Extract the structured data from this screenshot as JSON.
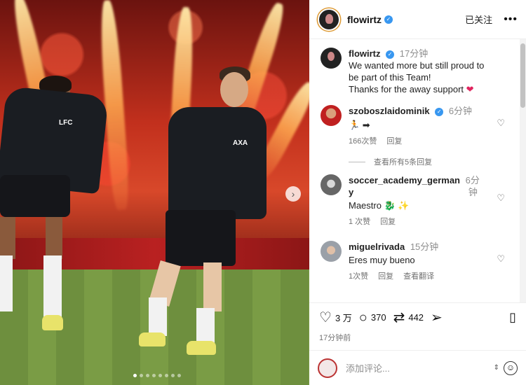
{
  "post": {
    "username": "flowirtz",
    "follow_label": "已关注",
    "more_label": "•••",
    "caption_time": "17分钟",
    "caption_line1": "We wanted more but still proud to",
    "caption_line2": "be part of this Team!",
    "caption_line3": "Thanks for the away support",
    "caption_heart": "❤",
    "next_arrow": "›",
    "carousel_index": 1,
    "carousel_total": 8
  },
  "comments": [
    {
      "username": "szoboszlaidominik",
      "time": "6分钟",
      "text": "🏃 ➡",
      "likes": "166次赞",
      "reply": "回复",
      "view_replies": "查看所有5条回复"
    },
    {
      "username_line1": "soccer_academy_german",
      "username_line2": "y",
      "time_line1": "6分",
      "time_line2": "钟",
      "text": "Maestro 🐉 ✨",
      "likes": "1 次赞",
      "reply": "回复"
    },
    {
      "username": "miguelrivada",
      "time": "15分钟",
      "text": "Eres muy bueno",
      "likes": "1次赞",
      "reply": "回复",
      "translate": "查看翻译"
    }
  ],
  "actions": {
    "likes": "3 万",
    "comments": "370",
    "reposts": "442",
    "posted": "17分钟前"
  },
  "composer": {
    "placeholder": "添加评论..."
  },
  "icons": {
    "verified": "verified-badge-icon",
    "like": "heart-icon",
    "comment": "comment-icon",
    "repost": "repost-icon",
    "share": "send-icon",
    "save": "bookmark-icon",
    "emoji": "emoji-icon"
  },
  "colors": {
    "verified": "#3897f0",
    "heart": "#e0245e",
    "text_muted": "#737373"
  }
}
